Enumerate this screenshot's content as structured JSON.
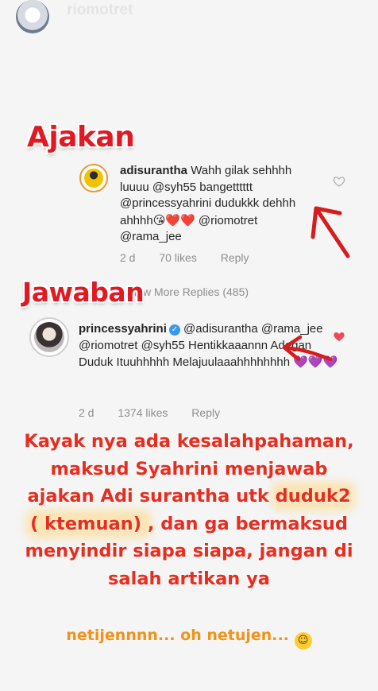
{
  "story": {
    "username": "riomotret"
  },
  "stickers": {
    "ajakan": "Ajakan",
    "jawaban": "Jawaban"
  },
  "comment1": {
    "username": "adisurantha",
    "text": " Wahh gilak sehhhh luuuu @syh55 bangetttttt @princessyahrini dudukkk dehhh ahhhh",
    "emojis": "😘❤️❤️",
    "mentions_tail": " @riomotret @rama_jee",
    "time": "2 d",
    "likes": "70 likes",
    "reply": "Reply"
  },
  "view_more": "View More Replies (485)",
  "comment2": {
    "username": "princessyahrini",
    "text": " @adisurantha @rama_jee @riomotret @syh55 Hentikkaaannn Adegan Duduk Ituuhhhhh Melajuulaaahhhhhhhh ",
    "emojis": "💜💜💜",
    "time": "2 d",
    "likes": "1374 likes",
    "reply": "Reply"
  },
  "caption": {
    "line1": "Kayak nya ada kesalahpahaman,",
    "line2": "maksud Syahrini menjawab",
    "line3a": "ajakan Adi surantha utk ",
    "line3b": "duduk2",
    "line4a": "( ktemuan) ",
    "line4b": ", dan ga bermaksud",
    "line5": "menyindir siapa siapa, jangan di",
    "line6": "salah artikan ya"
  },
  "footer": {
    "text": "netijennnn... oh netujen..."
  },
  "colors": {
    "sticker_red": "#e01a22",
    "caption_red": "#e62e20",
    "footer_orange": "#f29218",
    "verified_blue": "#3897f0",
    "heart_red": "#ed4956"
  }
}
